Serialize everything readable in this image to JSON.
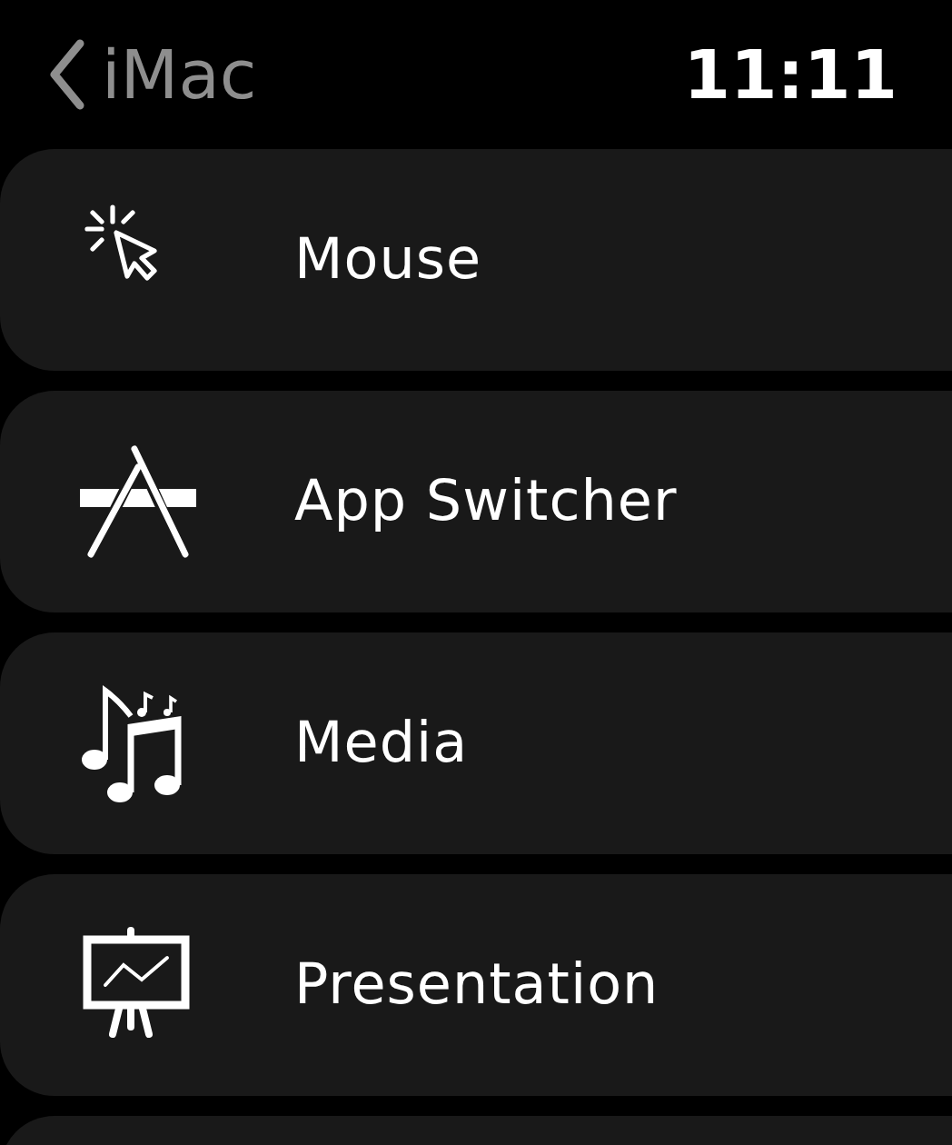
{
  "header": {
    "back_label": "iMac",
    "time": "11:11"
  },
  "items": [
    {
      "kind": "mouse",
      "label": "Mouse"
    },
    {
      "kind": "app-switcher",
      "label": "App Switcher"
    },
    {
      "kind": "media",
      "label": "Media"
    },
    {
      "kind": "presentation",
      "label": "Presentation"
    }
  ]
}
